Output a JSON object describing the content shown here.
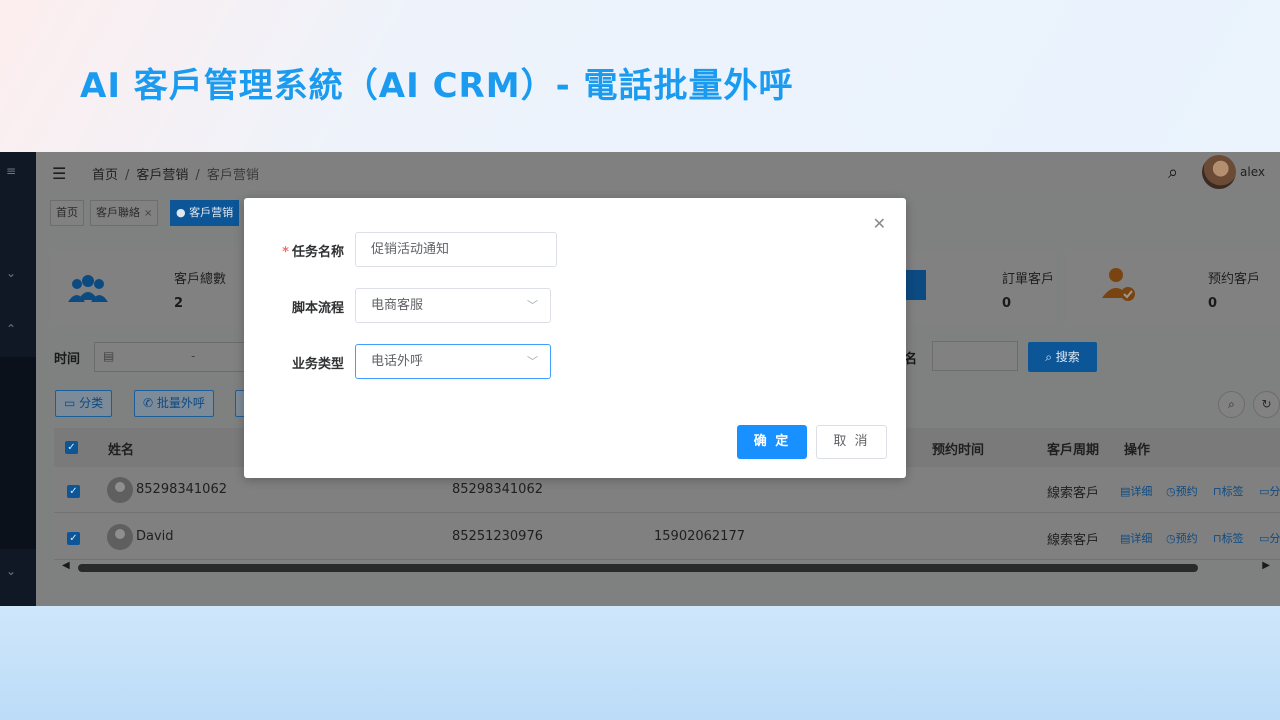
{
  "slide": {
    "title": "AI 客戶管理系統（AI CRM）- 電話批量外呼"
  },
  "header": {
    "breadcrumb": [
      "首页",
      "客戶营销",
      "客戶营销"
    ],
    "username": "alex"
  },
  "tabs": [
    {
      "label": "首页"
    },
    {
      "label": "客戶聯絡",
      "close": "×"
    },
    {
      "label": "客戶营销"
    }
  ],
  "stats": [
    {
      "label": "客戶總數",
      "value": "2"
    },
    {
      "label": "訂單客戶",
      "value": "0"
    },
    {
      "label": "预约客戶",
      "value": "0"
    }
  ],
  "filters": {
    "time_label": "时间",
    "date_separator": "-",
    "name_label": "名",
    "search_button": "搜索"
  },
  "actions": {
    "category": "分类",
    "batch_call": "批量外呼"
  },
  "table": {
    "headers": {
      "name": "姓名",
      "appointment_time": "预约时间",
      "customer_cycle": "客戶周期",
      "operations": "操作"
    },
    "rows": [
      {
        "name": "85298341062",
        "phone": "85298341062",
        "mobile": "",
        "cycle": "線索客戶"
      },
      {
        "name": "David",
        "phone": "85251230976",
        "mobile": "15902062177",
        "cycle": "線索客戶"
      }
    ],
    "ops": {
      "detail": "详细",
      "appoint": "预约",
      "tag": "标签",
      "more": "分"
    }
  },
  "modal": {
    "task_name_label": "任务名称",
    "task_name_value": "促销活动通知",
    "script_label": "脚本流程",
    "script_value": "电商客服",
    "biz_type_label": "业务类型",
    "biz_type_value": "电话外呼",
    "ok_button": "确 定",
    "cancel_button": "取 消"
  }
}
